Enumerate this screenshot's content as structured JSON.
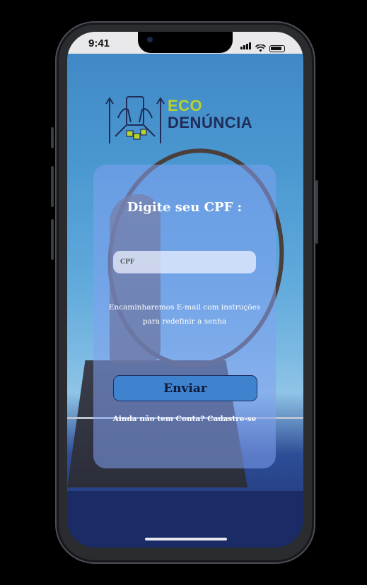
{
  "status_bar": {
    "time": "9:41"
  },
  "logo": {
    "line1": "ECO",
    "line2": "DENÚNCIA"
  },
  "form": {
    "title": "Digite seu CPF :",
    "cpf_placeholder": "CPF",
    "info_text": "Encaminharemos E-mail com instruções para redefinir a senha",
    "submit_label": "Enviar",
    "signup_link": "Ainda não tem Conta? Cadastre-se"
  },
  "colors": {
    "brand_green": "#b6d42c",
    "brand_navy": "#1f2c5a",
    "button": "#3f83cf"
  },
  "icons": [
    "phone-hands-icon",
    "wifi-icon",
    "signal-icon",
    "battery-icon"
  ]
}
